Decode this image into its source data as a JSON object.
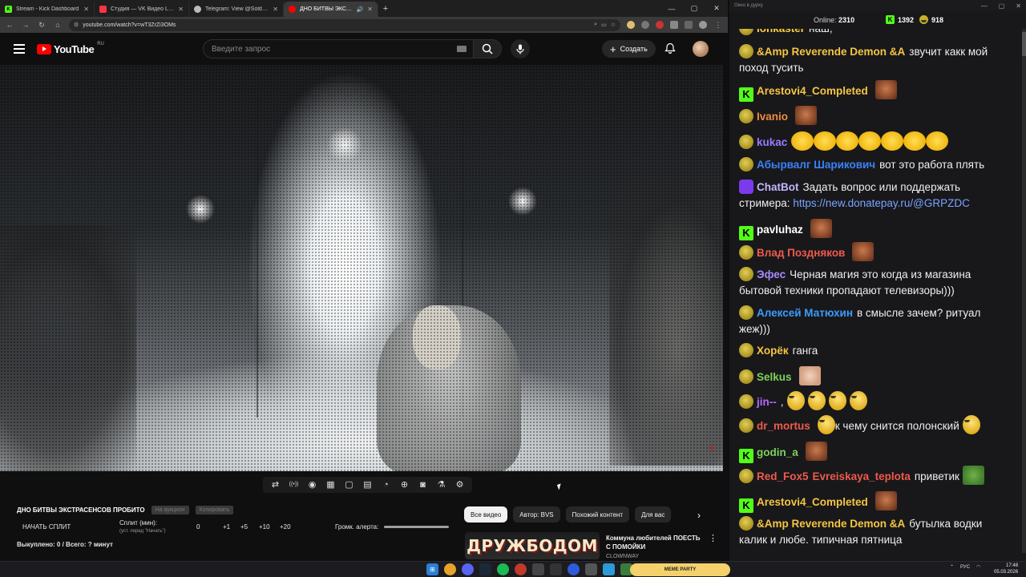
{
  "browser": {
    "tabs": [
      {
        "title": "Stream - Kick Dashboard",
        "fav_color": "#53fc18",
        "fav_glyph": "K",
        "active": false
      },
      {
        "title": "Студия — VK Видео Live",
        "fav_color": "#ff3347",
        "fav_glyph": "",
        "active": false
      },
      {
        "title": "Telegram: View @Soldierofforti",
        "fav_color": "#bbbbbb",
        "fav_glyph": "",
        "active": false
      },
      {
        "title": "ДНО БИТВЫ ЭКСТРАСЕНС",
        "fav_color": "#ff0000",
        "fav_glyph": "",
        "active": true
      }
    ],
    "new_tab": "+",
    "url": "youtube.com/watch?v=wT3ZrZi3OMs"
  },
  "youtube": {
    "logo_text": "YouTube",
    "region": "RU",
    "search_placeholder": "Введите запрос",
    "create_label": "Создать"
  },
  "tools_icons": [
    "repeat-icon",
    "broadcast-icon",
    "camera-record-icon",
    "clapper-icon",
    "screen-icon",
    "subtitles-icon",
    "speed-icon",
    "add-icon",
    "snapshot-icon",
    "flask-icon",
    "gear-icon"
  ],
  "panel": {
    "video_title": "ДНО БИТВЫ ЭКСТРАСЕНСОВ ПРОБИТО",
    "btn_auction": "На аукцион",
    "btn_copy": "Копировать",
    "start_split": "НАЧАТЬ СПЛИТ",
    "split_label": "Сплит (мин):",
    "split_hint": "(уст. перед \"Начать\")",
    "split_values": [
      "0",
      "+1",
      "+5",
      "+10",
      "+20"
    ],
    "alert_label": "Громк. алерта:",
    "bought": "Выкуплено: 0 / Всего: ? минут"
  },
  "chips": [
    "Все видео",
    "Автор: BVS",
    "Похожий контент",
    "Для вас"
  ],
  "recommendation": {
    "thumb_text": "ДРУЖБОДОМ",
    "title": "Коммуна любителей ПОЕСТЬ С ПОМОЙКИ",
    "channel": "CLOWNWAY"
  },
  "chat_window": {
    "title": "Окно в дурку",
    "online_label": "Online:",
    "online_value": "2310",
    "kick_count": "1392",
    "other_count": "918"
  },
  "chat": [
    {
      "icon": "p",
      "nick": "lonkaster",
      "color": "#ffd23f",
      "text": "наш,",
      "emotes": []
    },
    {
      "icon": "p",
      "nick": "&Amp Reverende Demon &A",
      "color": "#f5c542",
      "text": "звучит какк мой поход тусить",
      "emotes": []
    },
    {
      "icon": "k",
      "nick": "Arestovi4_Completed",
      "color": "#f5c542",
      "text": "",
      "emotes": [
        "face"
      ]
    },
    {
      "icon": "p",
      "nick": "Ivanio",
      "color": "#f08a3c",
      "text": "",
      "emotes": [
        "face"
      ]
    },
    {
      "icon": "p",
      "nick": "kukac",
      "color": "#9b7bff",
      "text": "",
      "emotes": [
        "laugh",
        "laugh",
        "laugh",
        "laugh",
        "laugh",
        "laugh",
        "laugh"
      ]
    },
    {
      "icon": "p",
      "nick": "Абырвалг Шарикович",
      "color": "#3b82f6",
      "text": "вот это работа плять",
      "emotes": []
    },
    {
      "icon": "bot",
      "nick": "ChatBot",
      "color": "#c4b5fd",
      "text": "Задать вопрос или поддержать стримера:",
      "link": "https://new.donatepay.ru/@GRPZDC",
      "emotes": []
    },
    {
      "icon": "k",
      "nick": "pavluhaz",
      "color": "#ffffff",
      "text": "",
      "emotes": [
        "face"
      ]
    },
    {
      "icon": "p",
      "nick": "Влад Поздняков",
      "color": "#ef5a4a",
      "text": "",
      "emotes": [
        "face"
      ]
    },
    {
      "icon": "p",
      "nick": "Эфес",
      "color": "#a78bfa",
      "text": "Черная магия это когда из магазина бытовой техники пропадают телевизоры)))",
      "emotes": []
    },
    {
      "icon": "p",
      "nick": "Алексей Матюхин",
      "color": "#3b9cff",
      "text": "в смысле зачем? ритуал жеж)))",
      "emotes": []
    },
    {
      "icon": "p",
      "nick": "Хорёк",
      "color": "#f5c542",
      "text": "ганга",
      "emotes": []
    },
    {
      "icon": "p",
      "nick": "Selkus",
      "color": "#7fd05a",
      "text": "",
      "emotes": [
        "cat"
      ]
    },
    {
      "icon": "p",
      "nick": "jin--",
      "color": "#b36bff",
      "text": ",",
      "emotes": [
        "pepe",
        "pepe",
        "pepe",
        "pepe"
      ]
    },
    {
      "icon": "p",
      "nick": "dr_mortus",
      "color": "#ef5a4a",
      "text": "к чему снится полонский",
      "emotes": [
        "pepe"
      ]
    },
    {
      "icon": "k",
      "nick": "godin_a",
      "color": "#7fd05a",
      "text": "",
      "emotes": [
        "face"
      ]
    },
    {
      "icon": "p",
      "nick": "Red_Fox5",
      "color": "#ef5a4a",
      "nick2": "Evreiskaya_teplota",
      "nick2_color": "#ef5a4a",
      "text": "приветик",
      "emotes": [
        "frog"
      ]
    },
    {
      "icon": "k",
      "nick": "Arestovi4_Completed",
      "color": "#f5c542",
      "text": "",
      "emotes": [
        "face"
      ]
    },
    {
      "icon": "p",
      "nick": "&Amp Reverende Demon &A",
      "color": "#f5c542",
      "text": "бутылка водки калик и любе. типичная пятница",
      "emotes": []
    }
  ],
  "taskbar": {
    "meme_label": "MEME PARTY",
    "lang": "РУС",
    "time": "17:48",
    "date": "05.03.2026"
  }
}
